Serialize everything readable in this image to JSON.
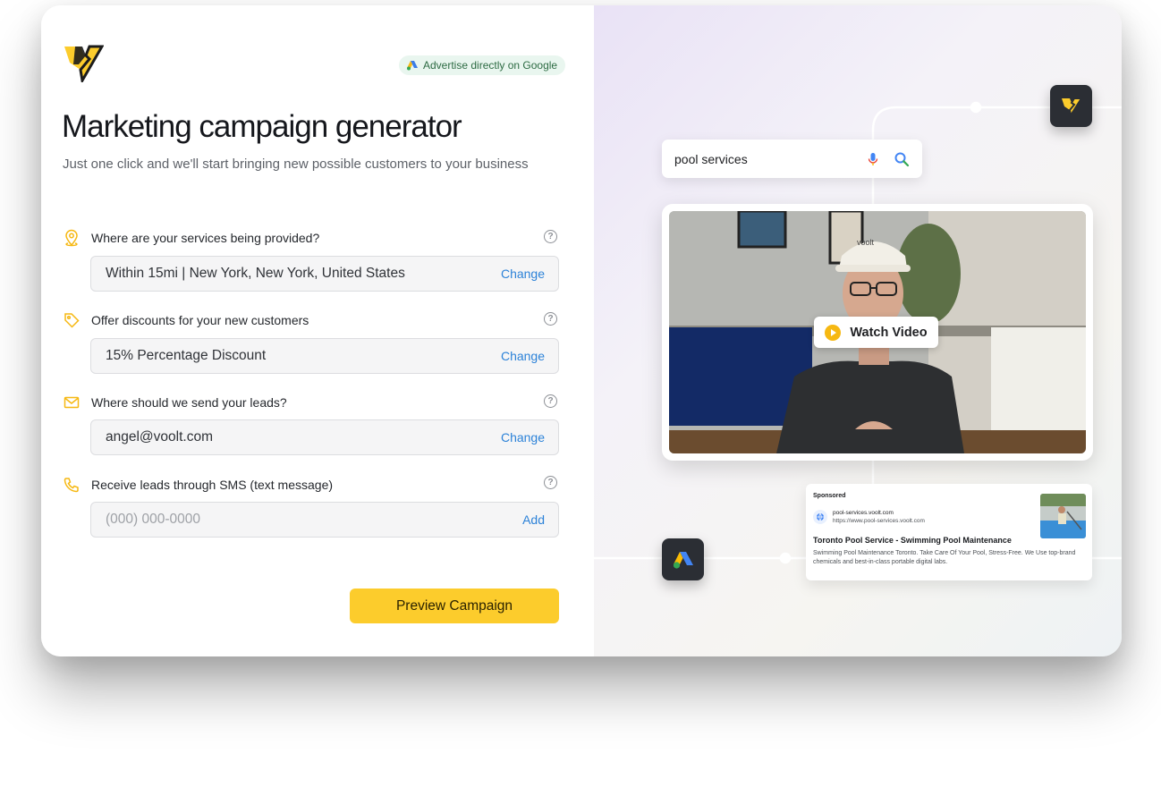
{
  "brand": {
    "logo_icon": "voolt-lightning-logo",
    "accent_color": "#fccc2c"
  },
  "header": {
    "badge_label": "Advertise directly on Google",
    "title": "Marketing campaign generator",
    "subtitle": "Just one click and we'll start bringing new possible customers to your business"
  },
  "fields": [
    {
      "label": "Where are your services being provided?",
      "value": "Within 15mi | New York, New York, United States",
      "action": "Change",
      "icon": "location-pin-icon"
    },
    {
      "label": "Offer discounts for your new customers",
      "value": "15% Percentage Discount",
      "action": "Change",
      "icon": "tag-icon"
    },
    {
      "label": "Where should we send your leads?",
      "value": "angel@voolt.com",
      "action": "Change",
      "icon": "envelope-icon"
    },
    {
      "label": "Receive leads through SMS (text message)",
      "placeholder": "(000) 000-0000",
      "action": "Add",
      "icon": "phone-icon"
    }
  ],
  "help_symbol": "?",
  "preview_button": "Preview Campaign",
  "preview": {
    "search_query": "pool services",
    "video_cap_text": "voolt",
    "watch_video_label": "Watch Video",
    "ad": {
      "sponsored": "Sponsored",
      "domain": "pool-services.voolt.com",
      "url": "https://www.pool-services.voolt.com",
      "title": "Toronto Pool Service - Swimming Pool Maintenance",
      "description": "Swimming Pool Maintenance Toronto. Take Care Of Your Pool, Stress-Free. We Use top-brand chemicals and best-in-class portable digital labs."
    }
  }
}
